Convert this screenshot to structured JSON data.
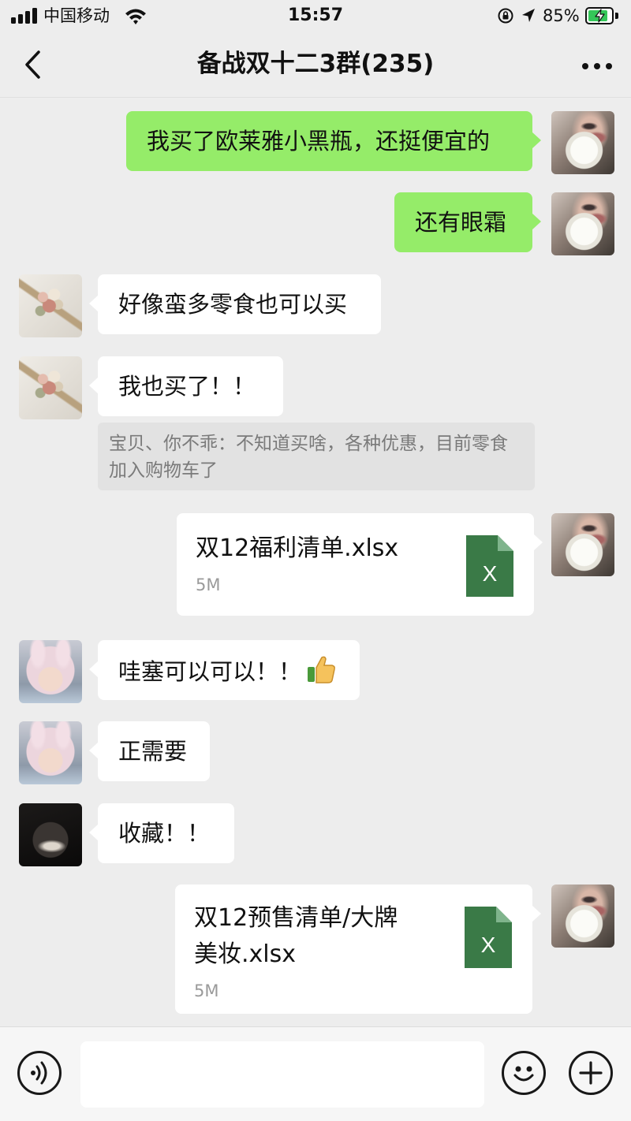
{
  "status_bar": {
    "carrier": "中国移动",
    "time": "15:57",
    "battery_percent": "85%",
    "battery_level": 0.85,
    "icons": [
      "signal-icon",
      "wifi-icon",
      "orientation-lock-icon",
      "location-arrow-icon",
      "battery-charging-icon"
    ]
  },
  "nav": {
    "title": "备战双十二3群(235)",
    "back_icon": "chevron-left-icon",
    "more_icon": "more-dots-icon"
  },
  "messages": [
    {
      "side": "out",
      "avatar": "white-flower",
      "text": "我买了欧莱雅小黑瓶，还挺便宜的"
    },
    {
      "side": "out",
      "avatar": "white-flower",
      "text": "还有眼霜"
    },
    {
      "side": "in",
      "avatar": "dried-bouquet",
      "text": "好像蛮多零食也可以买"
    },
    {
      "side": "in",
      "avatar": "dried-bouquet",
      "text": "我也买了！！",
      "quote": "宝贝、你不乖：不知道买啥，各种优惠，目前零食加入购物车了"
    },
    {
      "side": "out",
      "avatar": "white-flower",
      "type": "file",
      "file_name": "双12福利清单.xlsx",
      "file_size": "5M",
      "file_icon_letter": "X"
    },
    {
      "side": "in",
      "avatar": "bunny-hat",
      "text": "哇塞可以可以！！",
      "emoji": "thumbs-up-icon"
    },
    {
      "side": "in",
      "avatar": "bunny-hat",
      "text": "正需要"
    },
    {
      "side": "in",
      "avatar": "dark-silhouette",
      "text": "收藏！！"
    },
    {
      "side": "out",
      "avatar": "white-flower",
      "type": "file",
      "file_name_lines": [
        "双12预售清单/大牌",
        "美妆.xlsx"
      ],
      "file_size": "5M",
      "file_icon_letter": "X"
    }
  ],
  "input_bar": {
    "placeholder": "",
    "voice_icon": "voice-icon",
    "emoji_icon": "emoji-icon",
    "more_icon": "plus-icon"
  },
  "colors": {
    "background": "#ededed",
    "outgoing_bubble": "#95ec69",
    "incoming_bubble": "#ffffff",
    "excel_green": "#3a7a47",
    "battery_green": "#35c759"
  }
}
